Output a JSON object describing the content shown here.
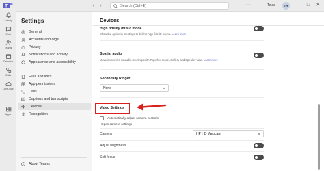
{
  "rail": {
    "items": [
      {
        "label": "Activity",
        "icon": "bell-icon"
      },
      {
        "label": "Chat",
        "icon": "chat-icon"
      },
      {
        "label": "Teams",
        "icon": "teams-icon"
      },
      {
        "label": "Calendar",
        "icon": "calendar-icon"
      },
      {
        "label": "Calls",
        "icon": "phone-icon"
      },
      {
        "label": "OneDrive",
        "icon": "cloud-icon"
      },
      {
        "label": "Apps",
        "icon": "apps-icon"
      }
    ]
  },
  "topbar": {
    "search_placeholder": "Search (Ctrl+E)",
    "more": "···",
    "org_name": "Telaa",
    "avatar_initials": "TR",
    "minimize": "–",
    "maximize": "□",
    "close": "✕"
  },
  "sidebar": {
    "title": "Settings",
    "group1": [
      "General",
      "Accounts and orgs",
      "Privacy",
      "Notifications and activity",
      "Appearance and accessibility"
    ],
    "group2": [
      "Files and links",
      "App permissions",
      "Calls",
      "Captions and transcripts",
      "Devices",
      "Recognition"
    ],
    "active": "Devices",
    "about": "About Teams"
  },
  "main": {
    "title": "Devices",
    "music_mode": {
      "title": "High fidelity music mode",
      "desc": "Show the option in meetings to deliver high fidelity sound.",
      "learn_more": "Learn more",
      "enabled": false
    },
    "spatial_audio": {
      "title": "Spatial audio",
      "desc": "Move immersive sound in meetings with Together mode, Gallery and Speaker view.",
      "learn_more": "Learn more",
      "enabled": false
    },
    "secondary_ringer": {
      "title": "Secondary Ringer",
      "value": "None"
    },
    "video_settings": {
      "title": "Video Settings",
      "auto_adjust": "Automatically adjust camera controls",
      "open_camera": "Open camera settings",
      "camera_label": "Camera",
      "camera_value": "HP HD Webcam",
      "brightness_label": "Adjust brightness",
      "brightness_enabled": false,
      "soft_focus_label": "Soft focus",
      "soft_focus_enabled": false
    }
  },
  "colors": {
    "accent": "#5b5fc7",
    "highlight_red": "#d9201c",
    "rail_bg": "#ebebeb",
    "sidebar_bg": "#f5f5f5"
  }
}
